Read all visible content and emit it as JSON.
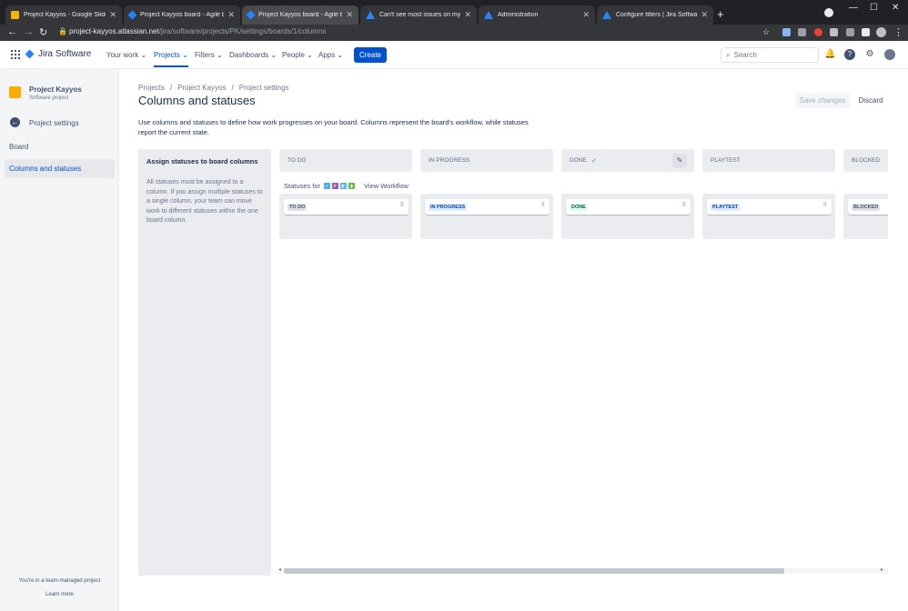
{
  "browser": {
    "tabs": [
      {
        "title": "Project Kayyos - Google Slides",
        "icon": "slides-icon"
      },
      {
        "title": "Project Kayyos board - Agile boa",
        "icon": "jira-icon"
      },
      {
        "title": "Project Kayyos board - Agile boa",
        "icon": "jira-icon",
        "active": true
      },
      {
        "title": "Can't see most issues on my boa",
        "icon": "atlassian-icon"
      },
      {
        "title": "Administration",
        "icon": "atlassian-icon"
      },
      {
        "title": "Configure filters | Jira Software C",
        "icon": "atlassian-icon"
      }
    ],
    "url_host": "project-kayyos.atlassian.net",
    "url_path": "/jira/software/projects/PK/settings/boards/1/columns"
  },
  "topnav": {
    "product": "Jira Software",
    "items": [
      "Your work",
      "Projects",
      "Filters",
      "Dashboards",
      "People",
      "Apps"
    ],
    "create_label": "Create",
    "search_placeholder": "Search"
  },
  "sidebar": {
    "project_name": "Project Kayyos",
    "project_type": "Software project",
    "back_label": "Project settings",
    "section": "Board",
    "active_item": "Columns and statuses",
    "team_note": "You're in a team-managed project",
    "learn_more": "Learn more"
  },
  "main": {
    "breadcrumb": [
      "Projects",
      "Project Kayyos",
      "Project settings"
    ],
    "title": "Columns and statuses",
    "save_label": "Save changes",
    "discard_label": "Discard",
    "description": "Use columns and statuses to define how work progresses on your board. Columns represent the board's workflow, while statuses report the current state.",
    "assign_title": "Assign statuses to board columns",
    "assign_text": "All statuses must be assigned to a column. If you assign multiple statuses to a single column, your team can move work to different statuses within the one board column.",
    "statuses_for": "Statuses for",
    "view_workflow": "View Workflow",
    "columns": [
      {
        "name": "TO DO",
        "status": "TO DO"
      },
      {
        "name": "IN PROGRESS",
        "status": "IN PROGRESS"
      },
      {
        "name": "DONE",
        "status": "DONE"
      },
      {
        "name": "PLAYTEST",
        "status": "PLAYTEST"
      },
      {
        "name": "BLOCKED",
        "status": "BLOCKED"
      }
    ]
  },
  "colors": {
    "brand": "#0052CC",
    "todo_lozenge": "#DFE1E6",
    "inprogress_lozenge": "#DEEBFF",
    "done_lozenge": "#E3FCEF"
  }
}
